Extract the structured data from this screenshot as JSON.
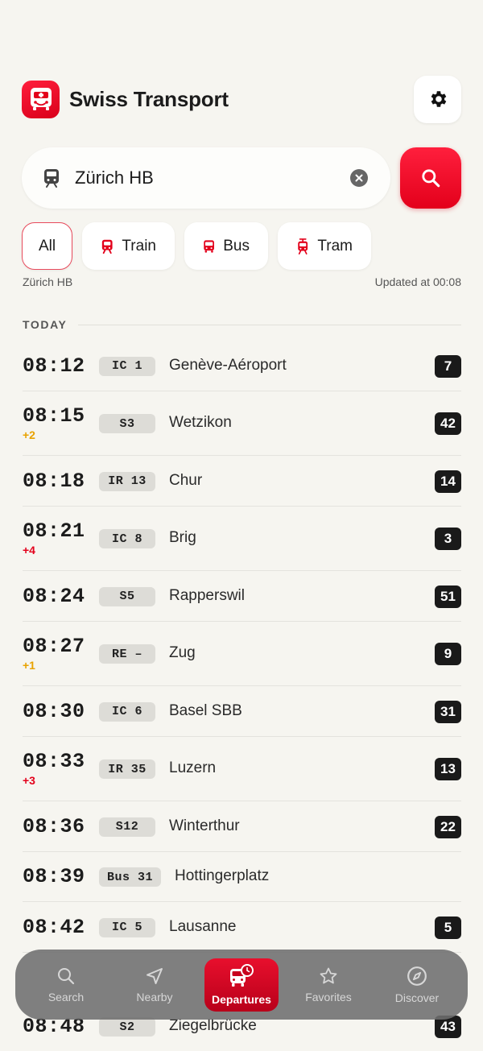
{
  "app": {
    "title": "Swiss Transport"
  },
  "icons": {
    "app": "bus-face-icon",
    "settings": "gear-icon",
    "station": "train-icon",
    "clear": "clear-x-icon",
    "search": "magnifier-icon"
  },
  "colors": {
    "accent": "#e3001b",
    "background": "#f6f5f0",
    "delay_minor": "#e8a200",
    "delay_major": "#e3001b",
    "platform_badge": "#1a1a1a"
  },
  "search": {
    "value": "Zürich HB",
    "placeholder": ""
  },
  "filters": [
    {
      "label": "All",
      "active": true
    },
    {
      "label": "Train",
      "active": false
    },
    {
      "label": "Bus",
      "active": false
    },
    {
      "label": "Tram",
      "active": false
    }
  ],
  "meta": {
    "station": "Zürich HB",
    "updated": "Updated at 00:08"
  },
  "section": {
    "label": "TODAY"
  },
  "departures": [
    {
      "time": "08:12",
      "delay": "",
      "line": "IC 1",
      "destination": "Genève-Aéroport",
      "platform": "7"
    },
    {
      "time": "08:15",
      "delay": "+2",
      "delay_level": "minor",
      "line": "S3",
      "destination": "Wetzikon",
      "platform": "42"
    },
    {
      "time": "08:18",
      "delay": "",
      "line": "IR 13",
      "destination": "Chur",
      "platform": "14"
    },
    {
      "time": "08:21",
      "delay": "+4",
      "delay_level": "major",
      "line": "IC 8",
      "destination": "Brig",
      "platform": "3"
    },
    {
      "time": "08:24",
      "delay": "",
      "line": "S5",
      "destination": "Rapperswil",
      "platform": "51"
    },
    {
      "time": "08:27",
      "delay": "+1",
      "delay_level": "minor",
      "line": "RE –",
      "destination": "Zug",
      "platform": "9"
    },
    {
      "time": "08:30",
      "delay": "",
      "line": "IC 6",
      "destination": "Basel SBB",
      "platform": "31"
    },
    {
      "time": "08:33",
      "delay": "+3",
      "delay_level": "major",
      "line": "IR 35",
      "destination": "Luzern",
      "platform": "13"
    },
    {
      "time": "08:36",
      "delay": "",
      "line": "S12",
      "destination": "Winterthur",
      "platform": "22"
    },
    {
      "time": "08:39",
      "delay": "",
      "line": "Bus 31",
      "destination": "Hottingerplatz",
      "platform": ""
    },
    {
      "time": "08:42",
      "delay": "",
      "line": "IC 5",
      "destination": "Lausanne",
      "platform": "5"
    },
    {
      "time": "08:48",
      "delay": "",
      "line": "S2",
      "destination": "Ziegelbrücke",
      "platform": "43"
    }
  ],
  "tabbar": {
    "items": [
      {
        "label": "Search",
        "icon": "search-icon",
        "active": false
      },
      {
        "label": "Nearby",
        "icon": "navigation-arrow-icon",
        "active": false
      },
      {
        "label": "Departures",
        "icon": "bus-clock-icon",
        "active": true
      },
      {
        "label": "Favorites",
        "icon": "star-icon",
        "active": false
      },
      {
        "label": "Discover",
        "icon": "compass-icon",
        "active": false
      }
    ]
  }
}
